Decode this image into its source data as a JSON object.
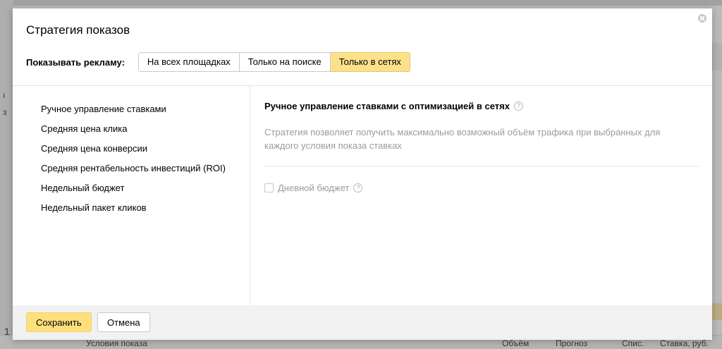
{
  "background": {
    "row_number": "1",
    "table_headers": [
      "Условия показа",
      "Объём",
      "Прогноз",
      "Спис.",
      "Ставка, руб."
    ]
  },
  "modal": {
    "title": "Стратегия показов",
    "show_label": "Показывать рекламу:",
    "placement_options": [
      "На всех площадках",
      "Только на поиске",
      "Только в сетях"
    ],
    "active_placement": "Только в сетях",
    "strategies": [
      "Ручное управление ставками",
      "Средняя цена клика",
      "Средняя цена конверсии",
      "Средняя рентабельность инвестиций (ROI)",
      "Недельный бюджет",
      "Недельный пакет кликов"
    ],
    "detail": {
      "title": "Ручное управление ставками с оптимизацией в сетях",
      "description": "Стратегия позволяет получить максимально возможный объём трафика при выбранных для каждого условия показа ставках",
      "daily_budget_label": "Дневной бюджет",
      "daily_budget_checked": false
    },
    "save_label": "Сохранить",
    "cancel_label": "Отмена"
  },
  "colors": {
    "accent_yellow": "#fde08a",
    "save_button": "#fddf7d",
    "muted_text": "#9b9b9b"
  }
}
